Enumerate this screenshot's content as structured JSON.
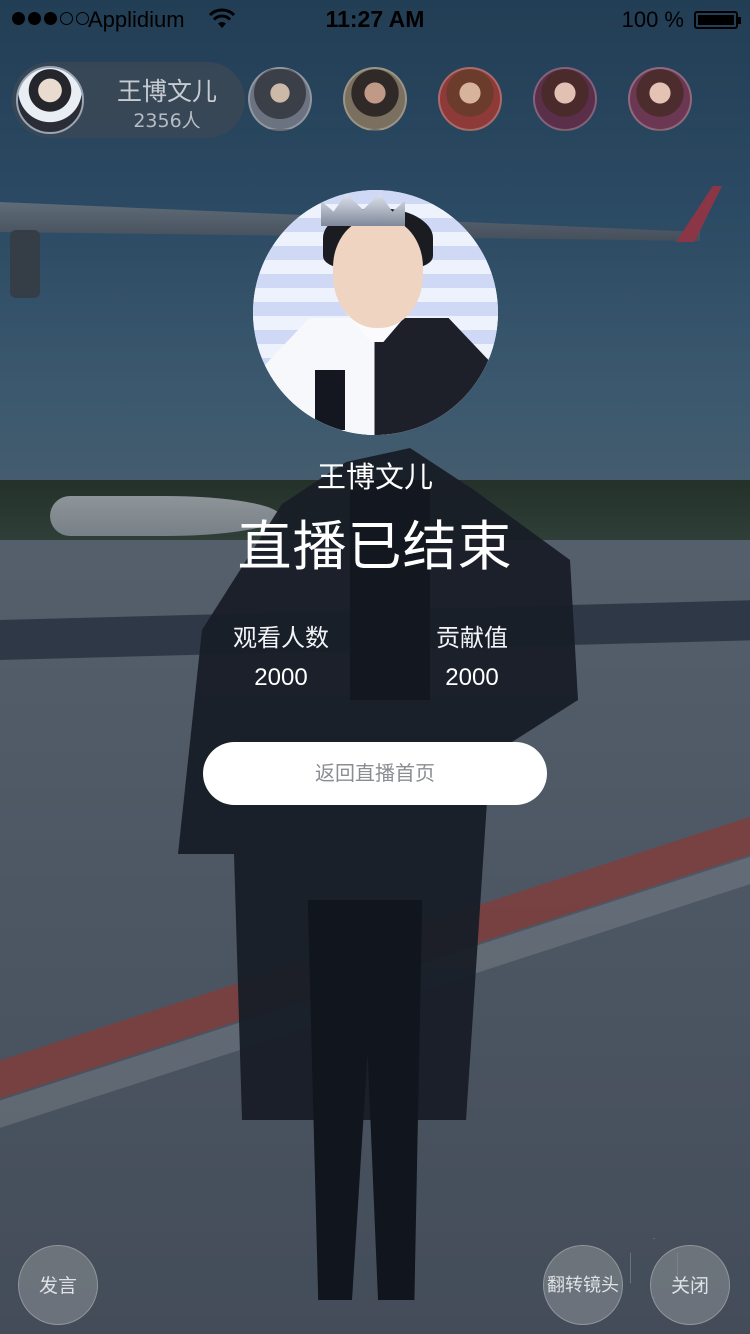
{
  "status_bar": {
    "carrier": "Applidium",
    "time": "11:27 AM",
    "battery": "100 %",
    "signal_icon": "signal-dots-icon",
    "wifi_icon": "wifi-icon",
    "battery_icon": "battery-icon"
  },
  "host": {
    "name": "王博文儿",
    "viewer_count": "2356人"
  },
  "viewers": [
    {
      "avatar": "viewer-avatar"
    },
    {
      "avatar": "viewer-avatar"
    },
    {
      "avatar": "viewer-avatar"
    },
    {
      "avatar": "viewer-avatar"
    },
    {
      "avatar": "viewer-avatar"
    }
  ],
  "ended": {
    "streamer_name": "王博文儿",
    "title": "直播已结束",
    "stats": [
      {
        "label": "观看人数",
        "value": "2000"
      },
      {
        "label": "贡献值",
        "value": "2000"
      }
    ],
    "back_label": "返回直播首页"
  },
  "controls": {
    "speak_label": "发言",
    "flip_label": "翻转镜头",
    "close_label": "关闭"
  }
}
